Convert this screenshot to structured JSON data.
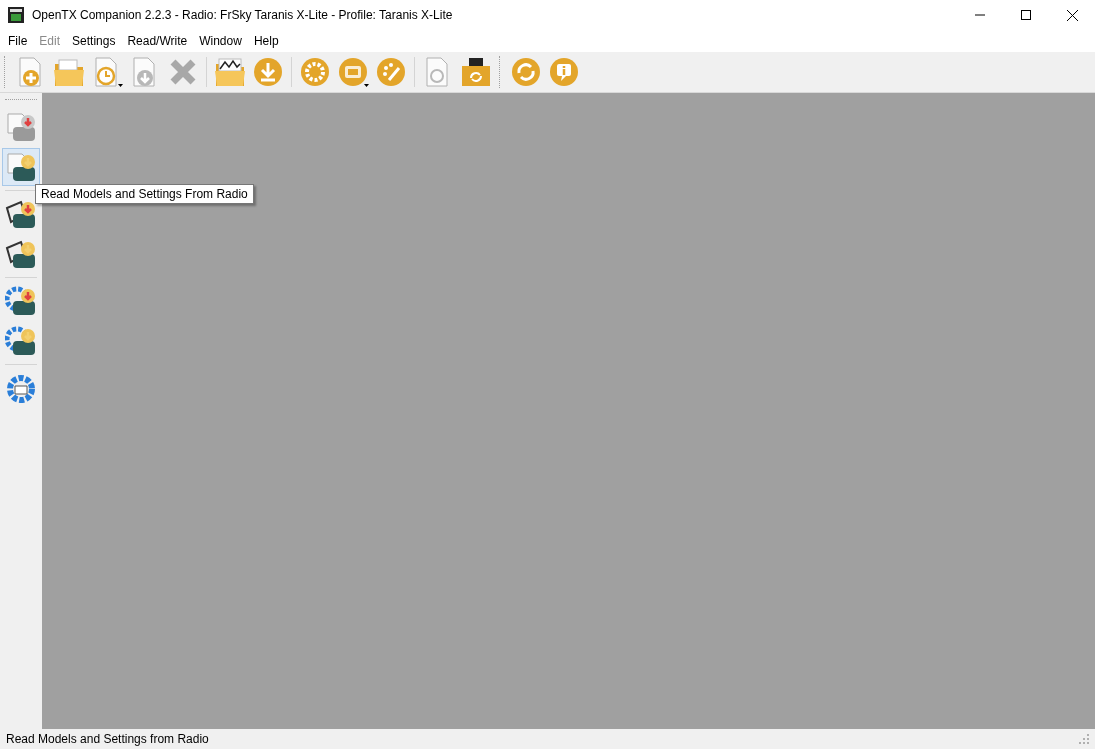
{
  "window": {
    "title": "OpenTX Companion 2.2.3 - Radio: FrSky Taranis X-Lite - Profile: Taranis X-Lite"
  },
  "menu": [
    {
      "label": "File",
      "disabled": false
    },
    {
      "label": "Edit",
      "disabled": true
    },
    {
      "label": "Settings",
      "disabled": false
    },
    {
      "label": "Read/Write",
      "disabled": false
    },
    {
      "label": "Window",
      "disabled": false
    },
    {
      "label": "Help",
      "disabled": false
    }
  ],
  "toolbars": [
    [
      [
        {
          "kind": "new-document",
          "disabled": false,
          "dropdown": false
        },
        {
          "kind": "folder",
          "disabled": false,
          "dropdown": false
        },
        {
          "kind": "recent-document",
          "disabled": false,
          "dropdown": true
        },
        {
          "kind": "save-document",
          "disabled": true,
          "dropdown": false
        },
        {
          "kind": "close",
          "disabled": true,
          "dropdown": false
        }
      ],
      [
        {
          "kind": "chart-folder",
          "disabled": false,
          "dropdown": false
        },
        {
          "kind": "download",
          "disabled": false,
          "dropdown": false
        }
      ],
      [
        {
          "kind": "settings",
          "disabled": false,
          "dropdown": false
        },
        {
          "kind": "radio-profile",
          "disabled": false,
          "dropdown": true
        },
        {
          "kind": "palette",
          "disabled": false,
          "dropdown": false
        }
      ],
      [
        {
          "kind": "print-document",
          "disabled": true,
          "dropdown": false
        },
        {
          "kind": "sd-card-folder",
          "disabled": false,
          "dropdown": false
        }
      ]
    ],
    [
      [
        {
          "kind": "sync",
          "disabled": false,
          "dropdown": false
        },
        {
          "kind": "info",
          "disabled": false,
          "dropdown": false
        }
      ]
    ]
  ],
  "side_toolbar": [
    [
      {
        "kind": "write-models",
        "disabled": true,
        "hovered": false
      },
      {
        "kind": "read-models",
        "disabled": false,
        "hovered": true
      }
    ],
    [
      {
        "kind": "write-backup",
        "disabled": false,
        "hovered": false
      },
      {
        "kind": "read-backup",
        "disabled": false,
        "hovered": false
      }
    ],
    [
      {
        "kind": "write-firmware",
        "disabled": false,
        "hovered": false
      },
      {
        "kind": "read-firmware",
        "disabled": false,
        "hovered": false
      }
    ],
    [
      {
        "kind": "bootloader",
        "disabled": false,
        "hovered": false
      }
    ]
  ],
  "tooltip": "Read Models and Settings From Radio",
  "status_bar": "Read Models and Settings from Radio"
}
